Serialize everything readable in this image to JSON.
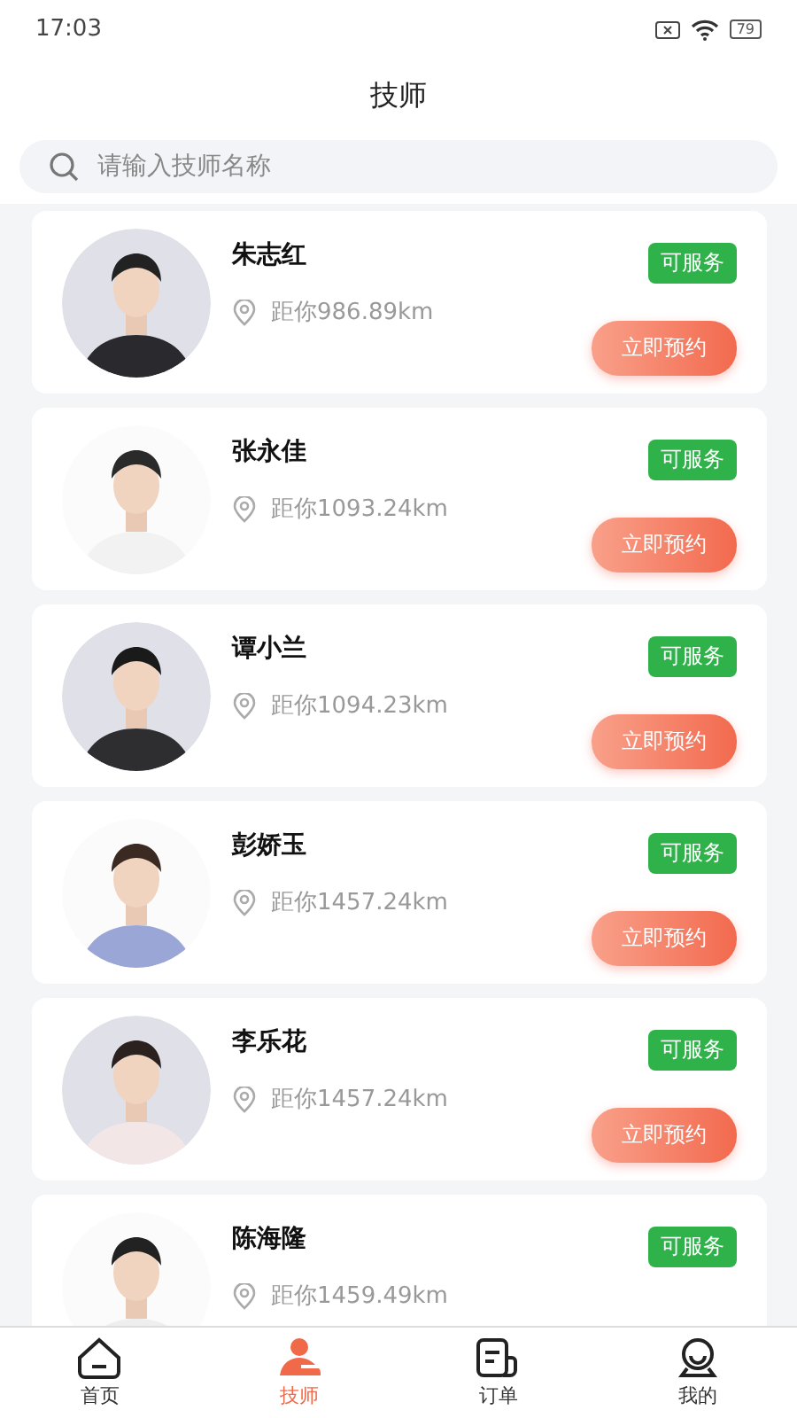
{
  "status_bar": {
    "time": "17:03",
    "battery": "79"
  },
  "title": "技师",
  "search": {
    "placeholder": "请输入技师名称"
  },
  "technicians": [
    {
      "name": "朱志红",
      "status": "可服务",
      "distance": "距你986.89km",
      "action": "立即预约"
    },
    {
      "name": "张永佳",
      "status": "可服务",
      "distance": "距你1093.24km",
      "action": "立即预约"
    },
    {
      "name": "谭小兰",
      "status": "可服务",
      "distance": "距你1094.23km",
      "action": "立即预约"
    },
    {
      "name": "彭娇玉",
      "status": "可服务",
      "distance": "距你1457.24km",
      "action": "立即预约"
    },
    {
      "name": "李乐花",
      "status": "可服务",
      "distance": "距你1457.24km",
      "action": "立即预约"
    },
    {
      "name": "陈海隆",
      "status": "可服务",
      "distance": "距你1459.49km"
    }
  ],
  "tabs": [
    {
      "label": "首页",
      "kind": "home",
      "selected": false
    },
    {
      "label": "技师",
      "kind": "tech",
      "selected": true
    },
    {
      "label": "订单",
      "kind": "order",
      "selected": false
    },
    {
      "label": "我的",
      "kind": "me",
      "selected": false
    }
  ]
}
